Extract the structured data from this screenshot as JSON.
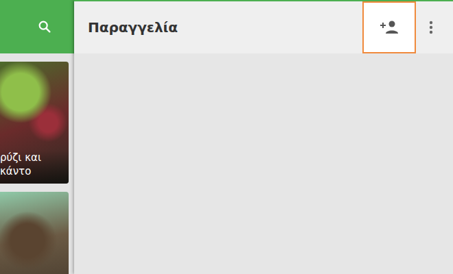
{
  "sidebar": {
    "cards": [
      {
        "lines": [
          "ρύζι και",
          "κάντο"
        ],
        "kind": "salad"
      },
      {
        "lines": [],
        "kind": "mushrooms"
      }
    ]
  },
  "order_panel": {
    "title": "Παραγγελία",
    "actions": [
      {
        "kind": "add-person",
        "highlighted": true
      },
      {
        "kind": "more",
        "highlighted": false
      }
    ]
  }
}
